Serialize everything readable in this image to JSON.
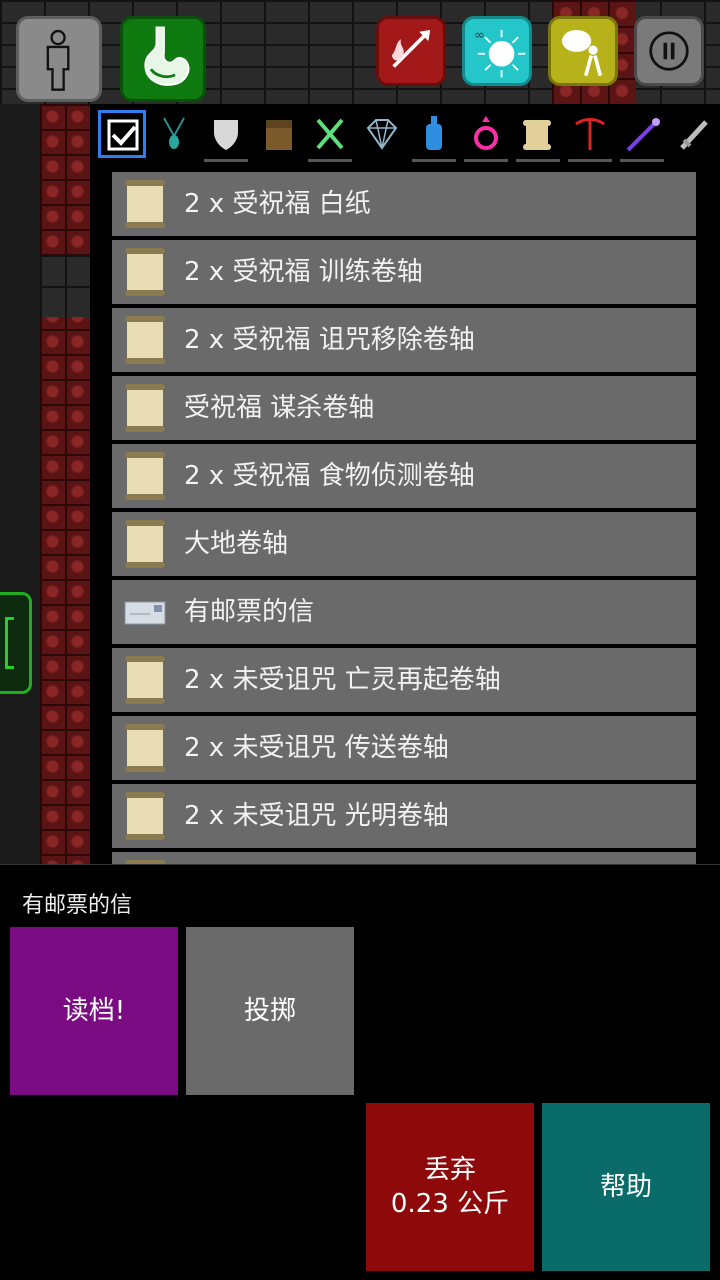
{
  "top_bar": {
    "character_icon": "character-silhouette-icon",
    "food_icon": "stomach-icon",
    "combat_icon": "fire-arrow-icon",
    "magic_icon": "magic-burst-icon",
    "loot_icon": "loot-sack-icon",
    "pause_icon": "pause-icon"
  },
  "filter_tabs": [
    {
      "icon": "check-all-icon",
      "selected": true
    },
    {
      "icon": "amulet-icon"
    },
    {
      "icon": "shield-icon"
    },
    {
      "icon": "box-icon"
    },
    {
      "icon": "fork-knife-icon"
    },
    {
      "icon": "gem-icon"
    },
    {
      "icon": "potion-icon"
    },
    {
      "icon": "ring-icon"
    },
    {
      "icon": "scroll-icon"
    },
    {
      "icon": "pickaxe-icon"
    },
    {
      "icon": "wand-icon"
    },
    {
      "icon": "sword-icon"
    }
  ],
  "inventory": {
    "items": [
      {
        "label": "2 x 受祝福 白纸",
        "icon": "scroll-icon"
      },
      {
        "label": "2 x 受祝福 训练卷轴",
        "icon": "scroll-icon"
      },
      {
        "label": "2 x 受祝福 诅咒移除卷轴",
        "icon": "scroll-icon"
      },
      {
        "label": "受祝福 谋杀卷轴",
        "icon": "scroll-icon"
      },
      {
        "label": "2 x 受祝福 食物侦测卷轴",
        "icon": "scroll-icon"
      },
      {
        "label": "大地卷轴",
        "icon": "scroll-icon"
      },
      {
        "label": "有邮票的信",
        "icon": "letter-icon"
      },
      {
        "label": "2 x 未受诅咒 亡灵再起卷轴",
        "icon": "scroll-icon"
      },
      {
        "label": "2 x 未受诅咒 传送卷轴",
        "icon": "scroll-icon"
      },
      {
        "label": "2 x 未受诅咒 光明卷轴",
        "icon": "scroll-icon"
      },
      {
        "label": "",
        "icon": "scroll-icon"
      }
    ]
  },
  "actions": {
    "selected_item": "有邮票的信",
    "read_label": "读档!",
    "throw_label": "投掷",
    "drop_label": "丢弃",
    "drop_weight": "0.23 公斤",
    "help_label": "帮助"
  },
  "colors": {
    "read": "#7a0b82",
    "throw": "#6a6a6a",
    "drop": "#8e0a0a",
    "help": "#0a6b6b",
    "tab_selected": "#2f7ef0"
  }
}
